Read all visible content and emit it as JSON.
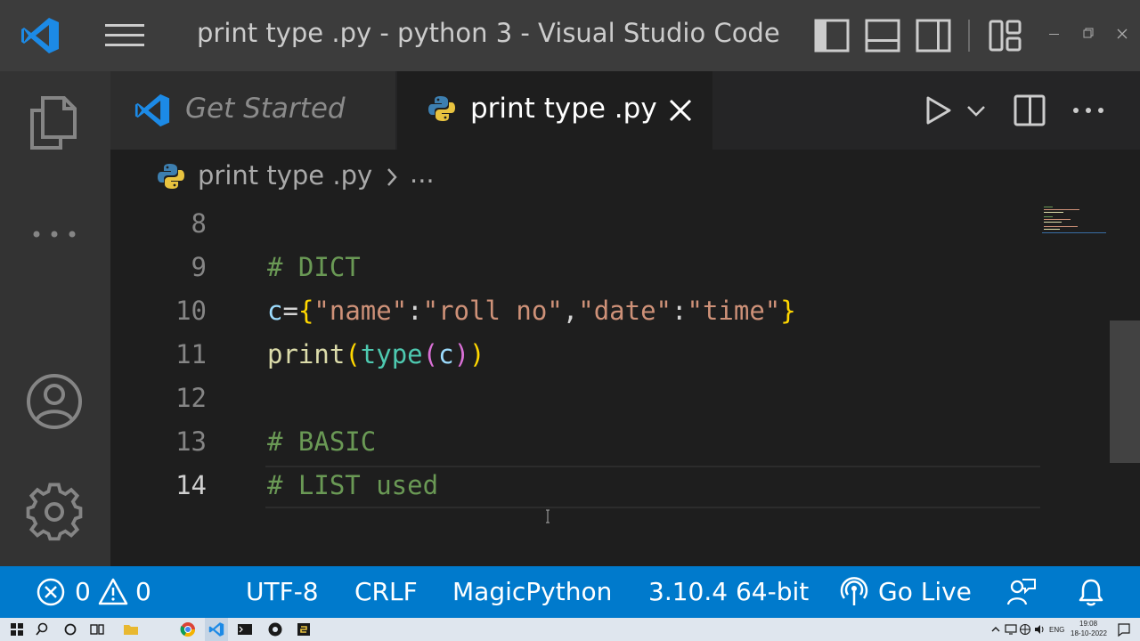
{
  "window": {
    "title": "print type .py - python 3 - Visual Studio Code"
  },
  "tabs": [
    {
      "label": "Get Started",
      "icon": "vscode-logo-icon"
    },
    {
      "label": "print type .py",
      "icon": "python-file-icon"
    }
  ],
  "breadcrumb": {
    "file": "print type .py",
    "ellipsis": "..."
  },
  "editor": {
    "lines": [
      {
        "number": "8"
      },
      {
        "number": "9"
      },
      {
        "number": "10"
      },
      {
        "number": "11"
      },
      {
        "number": "12"
      },
      {
        "number": "13"
      },
      {
        "number": "14"
      }
    ],
    "code": {
      "l9": "# DICT",
      "l10": {
        "var": "c",
        "eq": "=",
        "open": "{",
        "k1": "\"name\"",
        "colon": ":",
        "v1": "\"roll no\"",
        "comma": ",",
        "k2": "\"date\"",
        "v2": "\"time\"",
        "close": "}"
      },
      "l11": {
        "func": "print",
        "p1": "(",
        "builtin": "type",
        "p2": "(",
        "arg": "c",
        "p3": ")",
        "p4": ")"
      },
      "l13": "# BASIC",
      "l14": "# LIST used"
    },
    "active_line": "14"
  },
  "statusbar": {
    "errors": "0",
    "warnings": "0",
    "encoding": "UTF-8",
    "eol": "CRLF",
    "language": "MagicPython",
    "interpreter": "3.10.4 64-bit",
    "live": "Go Live"
  },
  "taskbar": {
    "language": "ENG",
    "time": "19:08",
    "date": "18-10-2022"
  },
  "colors": {
    "statusbar": "#007acc",
    "comment": "#6a9955",
    "string": "#ce9178",
    "variable": "#9cdcfe",
    "function": "#dcdcaa",
    "builtin": "#4ec9b0",
    "brace_gold": "#ffd700",
    "brace_violet": "#da70d6",
    "brace_blue": "#179fff"
  }
}
